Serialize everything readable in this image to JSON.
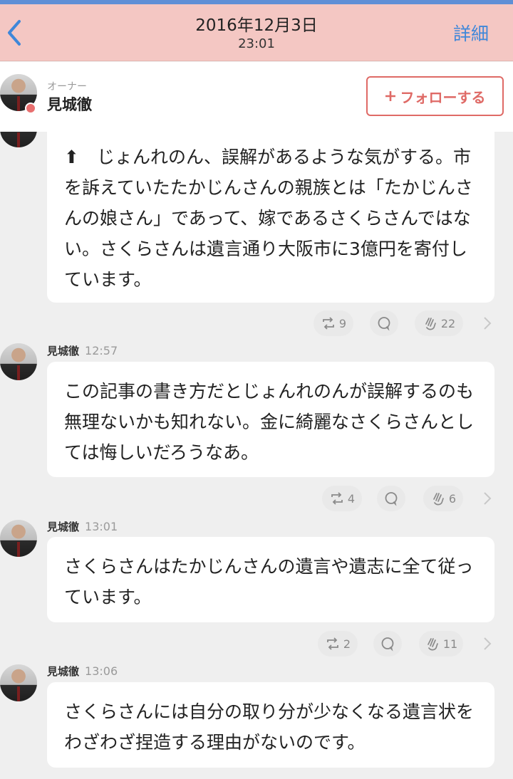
{
  "nav": {
    "date": "2016年12月3日",
    "time": "23:01",
    "detail_label": "詳細"
  },
  "owner": {
    "role": "オーナー",
    "name": "見城徹",
    "follow_label": "フォローする"
  },
  "messages": [
    {
      "sender": "",
      "time": "",
      "text": "⬆　じょんれのん、誤解があるような気がする。市を訴えていたたかじんさんの親族とは「たかじんさんの娘さん」であって、嫁であるさくらさんではない。さくらさんは遺言通り大阪市に3億円を寄付しています。",
      "repost_count": "9",
      "like_count": "22"
    },
    {
      "sender": "見城徹",
      "time": "12:57",
      "text": "この記事の書き方だとじょんれのんが誤解するのも無理ないかも知れない。金に綺麗なさくらさんとしては悔しいだろうなあ。",
      "repost_count": "4",
      "like_count": "6"
    },
    {
      "sender": "見城徹",
      "time": "13:01",
      "text": "さくらさんはたかじんさんの遺言や遺志に全て従っています。",
      "repost_count": "2",
      "like_count": "11"
    },
    {
      "sender": "見城徹",
      "time": "13:06",
      "text": "さくらさんには自分の取り分が少なくなる遺言状をわざわざ捏造する理由がないのです。",
      "repost_count": "",
      "like_count": ""
    }
  ],
  "icons": {
    "back": "chevron-left-icon",
    "repost": "repost-icon",
    "comment": "comment-icon",
    "clap": "clap-icon",
    "more": "chevron-right-icon"
  },
  "colors": {
    "header_bg": "#f4c7c3",
    "accent_blue": "#3f87d9",
    "follow_red": "#df6a66"
  }
}
